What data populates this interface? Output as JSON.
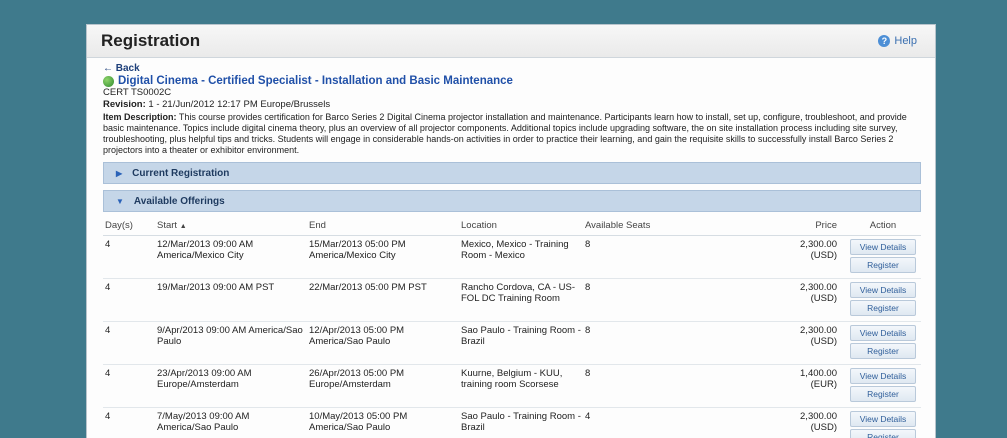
{
  "header": {
    "title": "Registration",
    "help_label": "Help"
  },
  "back_label": "← Back",
  "course": {
    "title": "Digital Cinema - Certified Specialist - Installation and Basic Maintenance",
    "code": "CERT TS0002C",
    "revision_label": "Revision:",
    "revision_value": " 1 - 21/Jun/2012 12:17 PM Europe/Brussels",
    "description_label": "Item Description:",
    "description": " This course provides certification for Barco Series 2 Digital Cinema projector installation and maintenance. Participants learn how to install, set up, configure, troubleshoot, and provide basic maintenance. Topics include digital cinema theory, plus an overview of all projector components. Additional topics include upgrading software, the on site installation process including site survey, troubleshooting, plus helpful tips and tricks. Students will engage in considerable hands-on activities in order to practice their learning, and gain the requisite skills to successfully install Barco Series 2 projectors into a theater or exhibitor environment."
  },
  "sections": {
    "current": {
      "label": "Current Registration",
      "arrow": "▶"
    },
    "available": {
      "label": "Available Offerings",
      "arrow": "▼"
    }
  },
  "table": {
    "headers": {
      "days": "Day(s)",
      "start": "Start",
      "start_sort": "▲",
      "end": "End",
      "location": "Location",
      "seats": "Available Seats",
      "price": "Price",
      "action": "Action"
    },
    "buttons": {
      "view": "View Details",
      "register": "Register"
    },
    "rows": [
      {
        "days": "4",
        "start": "12/Mar/2013 09:00 AM America/Mexico City",
        "end": "15/Mar/2013 05:00 PM America/Mexico City",
        "location": "Mexico, Mexico - Training Room - Mexico",
        "seats": "8",
        "price": "2,300.00",
        "currency": "(USD)"
      },
      {
        "days": "4",
        "start": "19/Mar/2013 09:00 AM PST",
        "end": "22/Mar/2013 05:00 PM PST",
        "location": "Rancho Cordova, CA - US-FOL DC Training Room",
        "seats": "8",
        "price": "2,300.00",
        "currency": "(USD)"
      },
      {
        "days": "4",
        "start": "9/Apr/2013 09:00 AM America/Sao Paulo",
        "end": "12/Apr/2013 05:00 PM America/Sao Paulo",
        "location": "Sao Paulo - Training Room - Brazil",
        "seats": "8",
        "price": "2,300.00",
        "currency": "(USD)"
      },
      {
        "days": "4",
        "start": "23/Apr/2013 09:00 AM Europe/Amsterdam",
        "end": "26/Apr/2013 05:00 PM Europe/Amsterdam",
        "location": "Kuurne, Belgium - KUU, training room Scorsese",
        "seats": "8",
        "price": "1,400.00",
        "currency": "(EUR)"
      },
      {
        "days": "4",
        "start": "7/May/2013 09:00 AM America/Sao Paulo",
        "end": "10/May/2013 05:00 PM America/Sao Paulo",
        "location": "Sao Paulo - Training Room - Brazil",
        "seats": "4",
        "price": "2,300.00",
        "currency": "(USD)"
      }
    ]
  },
  "colors": {
    "background": "#3f7a8c",
    "section_bar": "#c5d6e8",
    "link": "#2050a8"
  }
}
